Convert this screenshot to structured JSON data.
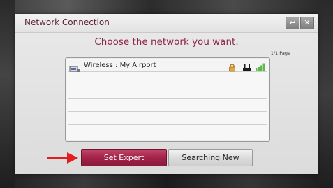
{
  "dialog": {
    "title": "Network Connection",
    "back_icon": "back-arrow-icon",
    "close_icon": "close-icon",
    "prompt": "Choose the network you want.",
    "page_indicator": "1/1 Page"
  },
  "networks": [
    {
      "label": "Wireless : My Airport",
      "icon": "wireless-network-icon",
      "secured": true,
      "signal_bars": 4
    }
  ],
  "buttons": {
    "set_expert": "Set Expert",
    "searching_new": "Searching New"
  },
  "colors": {
    "accent": "#a12348",
    "title": "#5a1f33",
    "prompt": "#8f2646",
    "signal": "#5fb84a",
    "annotation_arrow": "#e21e1e"
  }
}
